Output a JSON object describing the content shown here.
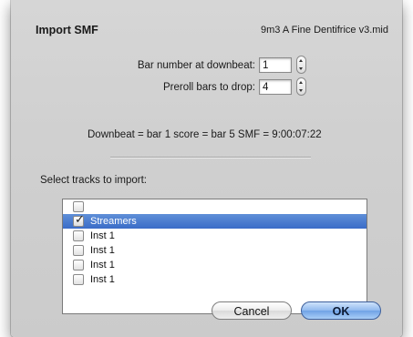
{
  "dialog": {
    "title": "Import SMF",
    "filename": "9m3 A Fine Dentifrice v3.mid"
  },
  "fields": {
    "bar_number_label": "Bar number at downbeat:",
    "bar_number_value": "1",
    "preroll_label": "Preroll bars to drop:",
    "preroll_value": "4"
  },
  "summary": "Downbeat = bar 1 score = bar 5 SMF = 9:00:07:22",
  "tracks": {
    "label": "Select tracks to import:",
    "items": [
      {
        "label": "",
        "checked": false,
        "selected": false
      },
      {
        "label": "Streamers",
        "checked": true,
        "selected": true
      },
      {
        "label": "Inst 1",
        "checked": false,
        "selected": false
      },
      {
        "label": "Inst 1",
        "checked": false,
        "selected": false
      },
      {
        "label": "Inst 1",
        "checked": false,
        "selected": false
      },
      {
        "label": "Inst 1",
        "checked": false,
        "selected": false
      }
    ]
  },
  "buttons": {
    "cancel": "Cancel",
    "ok": "OK"
  },
  "colors": {
    "selection": "#3a6cc8",
    "default_button": "#6fa2e6"
  },
  "icons": {
    "stepper": "up-down-stepper-icon",
    "checkbox": "checkbox-icon",
    "checkmark": "checkmark-icon"
  }
}
